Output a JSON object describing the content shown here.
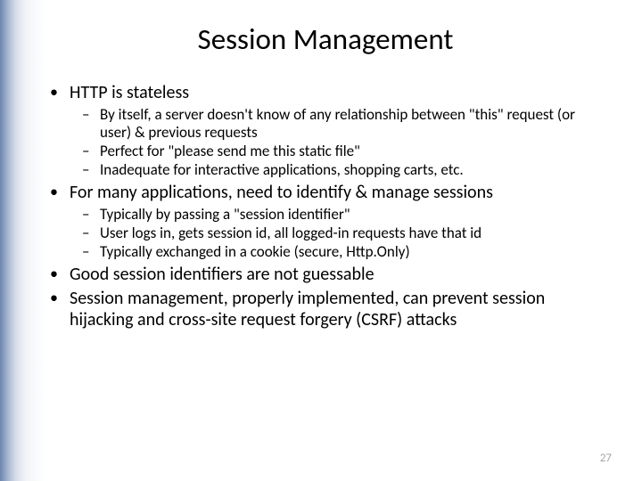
{
  "title": "Session Management",
  "bullets": {
    "b1": "HTTP is stateless",
    "b1s1": "By itself, a server doesn't know of any relationship between \"this\" request (or user) & previous requests",
    "b1s2": "Perfect for \"please send me this static file\"",
    "b1s3": "Inadequate for interactive applications, shopping carts, etc.",
    "b2": "For many applications, need to identify & manage sessions",
    "b2s1": "Typically by passing a \"session identifier\"",
    "b2s2": "User logs in, gets session id, all logged-in requests have that id",
    "b2s3": "Typically exchanged in a cookie (secure, Http.Only)",
    "b3": "Good session identifiers are not guessable",
    "b4": "Session management, properly implemented,  can prevent session hijacking and cross-site request forgery (CSRF) attacks"
  },
  "page_number": "27"
}
